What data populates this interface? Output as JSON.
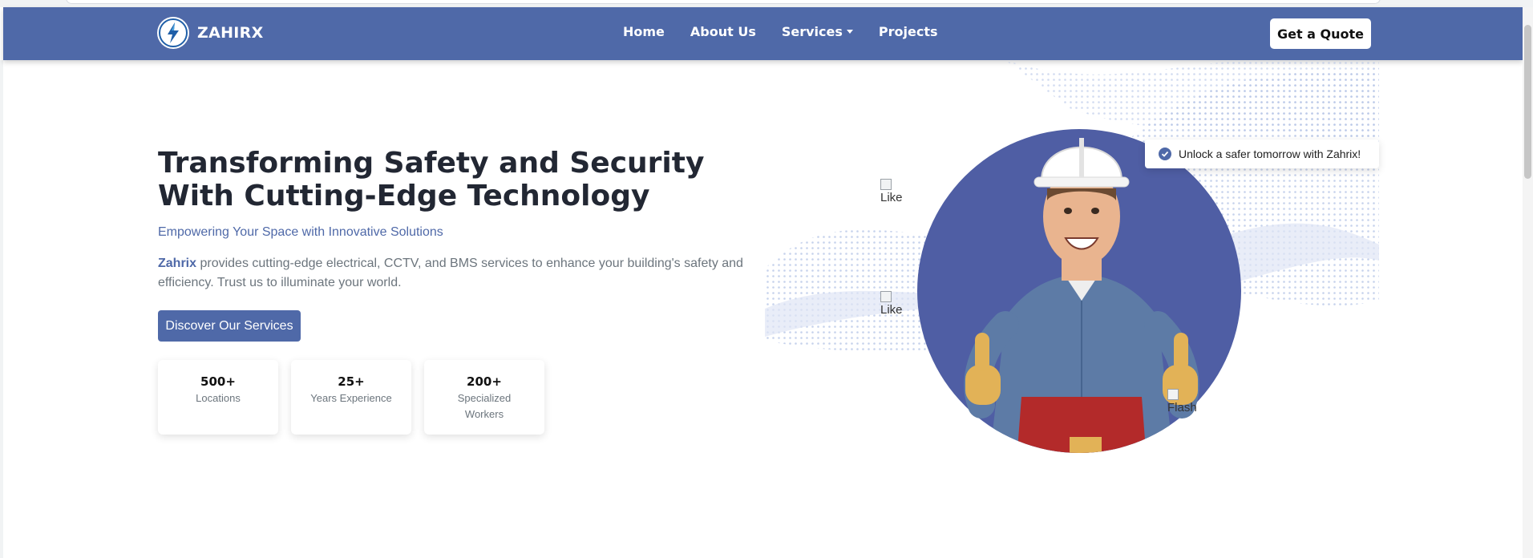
{
  "brand": {
    "name": "ZAHIRX",
    "logo_icon": "lightning-bolt-icon"
  },
  "nav": {
    "links": [
      {
        "label": "Home"
      },
      {
        "label": "About Us"
      },
      {
        "label": "Services",
        "has_dropdown": true
      },
      {
        "label": "Projects"
      }
    ],
    "quote_button": "Get a Quote"
  },
  "hero": {
    "title": "Transforming Safety and Security With Cutting-Edge Technology",
    "subtitle": "Empowering Your Space with Innovative Solutions",
    "description_brand": "Zahrix",
    "description_rest": " provides cutting-edge electrical, CCTV, and BMS services to enhance your building's safety and efficiency. Trust us to illuminate your world.",
    "cta": "Discover Our Services",
    "stats": [
      {
        "number": "500+",
        "label": "Locations"
      },
      {
        "number": "25+",
        "label": "Years Experience"
      },
      {
        "number": "200+",
        "label": "Specialized Workers"
      }
    ],
    "badge": "Unlock a safer tomorrow with Zahrix!",
    "broken_images": [
      {
        "alt": "Like"
      },
      {
        "alt": "Like"
      },
      {
        "alt": "Flash"
      }
    ]
  },
  "colors": {
    "primary": "#4f69a8",
    "text_dark": "#222733",
    "muted": "#6c757d",
    "skin": "#e9b48f",
    "shirt": "#5d7ba6",
    "helmet": "#ffffff",
    "gloves": "#e2b257",
    "belt": "#b32a2a"
  }
}
